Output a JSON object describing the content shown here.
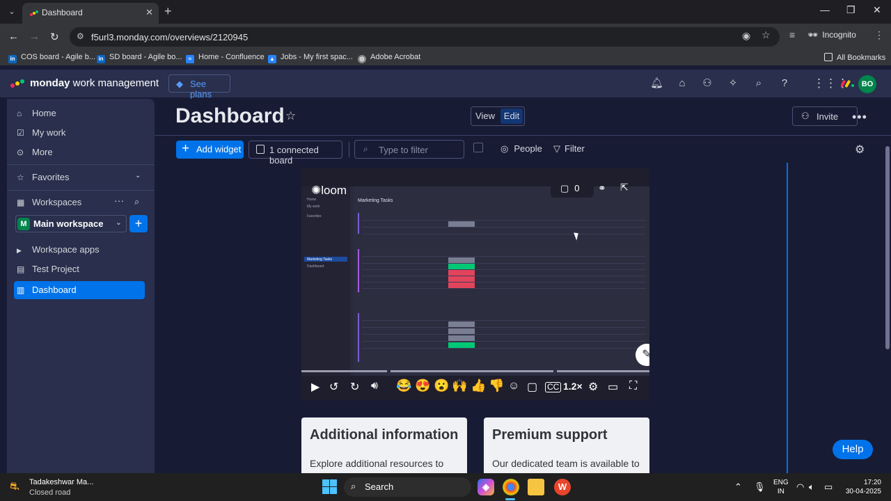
{
  "browser": {
    "tab_title": "Dashboard",
    "url": "f5url3.monday.com/overviews/2120945",
    "incognito_label": "Incognito",
    "all_bookmarks": "All Bookmarks",
    "bookmarks": [
      {
        "label": "COS board - Agile b...",
        "icon": "linkedin-icon",
        "color": "#0a66c2"
      },
      {
        "label": "SD board - Agile bo...",
        "icon": "linkedin-icon",
        "color": "#0a66c2"
      },
      {
        "label": "Home - Confluence",
        "icon": "confluence-icon",
        "color": "#2684ff"
      },
      {
        "label": "Jobs - My first spac...",
        "icon": "jira-icon",
        "color": "#2684ff"
      },
      {
        "label": "Adobe Acrobat",
        "icon": "globe-icon",
        "color": "#888888"
      }
    ]
  },
  "header": {
    "brand_bold": "monday",
    "brand_rest": " work management",
    "see_plans": "See plans",
    "avatar_initials": "BO"
  },
  "sidebar": {
    "home": "Home",
    "my_work": "My work",
    "more": "More",
    "favorites": "Favorites",
    "workspaces": "Workspaces",
    "workspace_badge": "M",
    "workspace_name": "Main workspace",
    "items": [
      {
        "label": "Workspace apps"
      },
      {
        "label": "Test Project"
      },
      {
        "label": "Dashboard"
      }
    ]
  },
  "main": {
    "title": "Dashboard",
    "view_label": "View",
    "edit_label": "Edit",
    "invite_label": "Invite",
    "add_widget": "Add widget",
    "connected_boards": "1 connected board",
    "filter_placeholder": "Type to filter",
    "people_label": "People",
    "filter_label": "Filter"
  },
  "video": {
    "logo": "loom",
    "board_title": "Marketing Tasks",
    "comment_count": "0",
    "speed": "1.2×",
    "progress": 0.25,
    "sidebar_items": [
      "Home",
      "My work",
      "Favorites",
      "Marketing Tasks",
      "Dashboard"
    ]
  },
  "cards": [
    {
      "title": "Additional information",
      "body": "Explore additional resources to"
    },
    {
      "title": "Premium support",
      "body": "Our dedicated team is available to"
    }
  ],
  "help_label": "Help",
  "taskbar": {
    "weather_title": "Tadakeshwar Ma...",
    "weather_sub": "Closed road",
    "search_label": "Search",
    "lang_1": "ENG",
    "lang_2": "IN",
    "time": "17:20",
    "date": "30-04-2025"
  }
}
